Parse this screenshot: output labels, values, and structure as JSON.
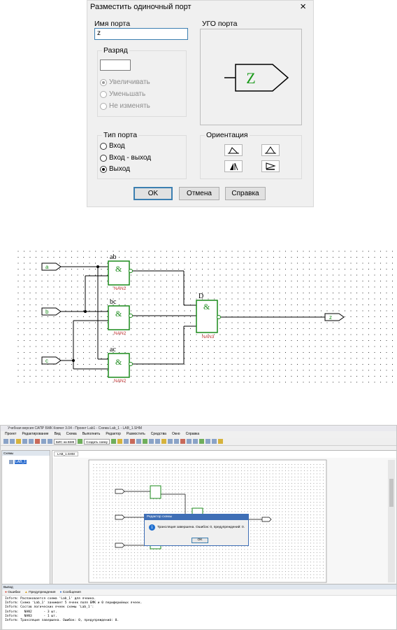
{
  "dialog": {
    "title": "Разместить одиночный порт",
    "close": "×",
    "port_name_label": "Имя порта",
    "port_name_value": "z",
    "ugo_label": "УГО порта",
    "ugo_symbol": "Z",
    "bit_group": "Разряд",
    "bit_value": "",
    "bit_options": [
      "Увеличивать",
      "Уменьшать",
      "Не изменять"
    ],
    "type_group": "Тип порта",
    "type_options": [
      "Вход",
      "Вход - выход",
      "Выход"
    ],
    "type_selected": "Выход",
    "orientation_group": "Ориентация",
    "ok": "OK",
    "cancel": "Отмена",
    "help": "Справка"
  },
  "schematic": {
    "inputs": [
      "a",
      "b",
      "c"
    ],
    "output": "z",
    "gates": [
      {
        "label": "ab",
        "symbol": "&",
        "type": "NAN2"
      },
      {
        "label": "bc",
        "symbol": "&",
        "type": "NAN2"
      },
      {
        "label": "ac",
        "symbol": "&",
        "type": "NAN2"
      },
      {
        "label": "D",
        "symbol": "&",
        "type": "NAN3"
      }
    ]
  },
  "app": {
    "title": "Учебная версия САПР БМК Ковчег 3.04 - Проект Lab1 - Схема Lab_1 - LAB_1.SHM",
    "menu": [
      "Проект",
      "Редактирование",
      "Вид",
      "Схема",
      "Выполнить",
      "Редактор",
      "Размостить",
      "Средства",
      "Окно",
      "Справка"
    ],
    "bmk_select": "БИС на БМК",
    "create_scheme": "Создать схему",
    "left_panel_title": "Схемы",
    "tree_item": "LAB_1",
    "doc_tab": "LAB_1.SHM",
    "msgbox": {
      "title": "Редактор схемы",
      "text": "Трансляция завершена. Ошибок: 0, предупреждений: 0.",
      "ok": "OK"
    },
    "output": {
      "title": "Вывод",
      "tabs": [
        "Ошибки",
        "Предупреждения",
        "Сообщения"
      ],
      "lines": [
        "Inform: Распаковается схема 'Lab_1' для ячеика.",
        "Inform: Схема 'Lab_1' занимает 5 ячеек поля БМК и 0 периферийных ячеек.",
        "Inform: Состав логических ячеек схемы 'Lab_1':",
        "Inform:   NAN2      - 3 шт.",
        "Inform:   NAN3      - 1 шт.",
        "Inform: Трансляция завершена. Ошибок: 0, предупреждений: 0."
      ]
    }
  }
}
